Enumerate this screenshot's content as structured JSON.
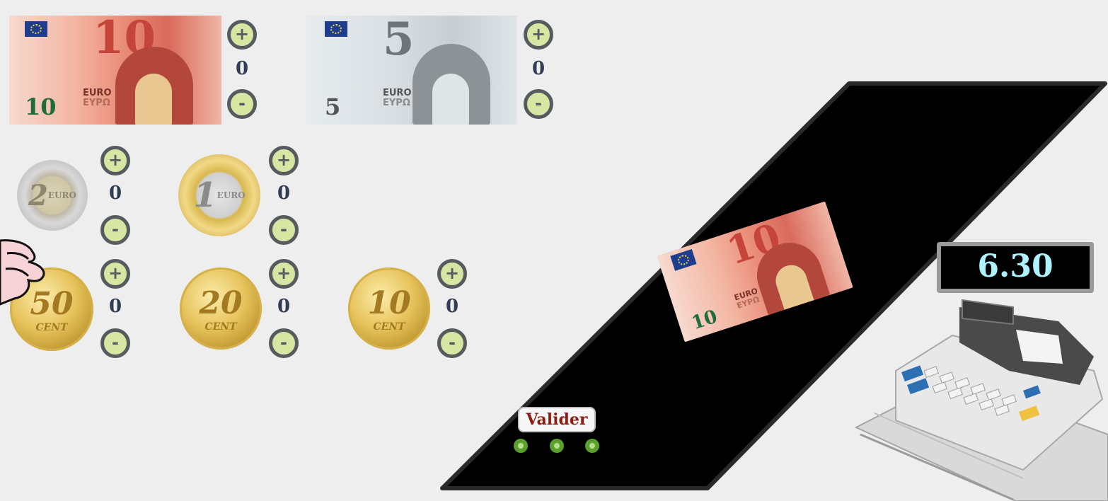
{
  "notes": [
    {
      "id": "10",
      "big": "10",
      "corner": "10",
      "euro": "EURO",
      "eypo": "EYPΩ",
      "count": "0",
      "plus": "+",
      "minus": "-"
    },
    {
      "id": "5",
      "big": "5",
      "corner": "5",
      "euro": "EURO",
      "eypo": "EYPΩ",
      "count": "0",
      "plus": "+",
      "minus": "-"
    }
  ],
  "coins": [
    {
      "id": "2e",
      "face": "2",
      "sub": "EURO",
      "count": "0",
      "plus": "+",
      "minus": "-"
    },
    {
      "id": "1e",
      "face": "1",
      "sub": "EURO",
      "count": "0",
      "plus": "+",
      "minus": "-"
    },
    {
      "id": "50c",
      "face": "50",
      "sub": "CENT",
      "count": "0",
      "plus": "+",
      "minus": "-"
    },
    {
      "id": "20c",
      "face": "20",
      "sub": "CENT",
      "count": "0",
      "plus": "+",
      "minus": "-"
    },
    {
      "id": "10c",
      "face": "10",
      "sub": "CENT",
      "count": "0",
      "plus": "+",
      "minus": "-"
    }
  ],
  "tray_note": {
    "big": "10",
    "corner": "10",
    "euro": "EURO",
    "eypo": "EYPΩ"
  },
  "register": {
    "display": "6.30"
  },
  "valider_label": "Valider",
  "colors": {
    "stepper_fill": "#d8e6a4",
    "stepper_border": "#555b5e",
    "count": "#2f3e52",
    "display_text": "#aef2ff",
    "valider_text": "#8e1c12",
    "dot": "#5aa02c"
  },
  "icons": [
    "hand-pointer-icon",
    "cash-register-icon"
  ]
}
